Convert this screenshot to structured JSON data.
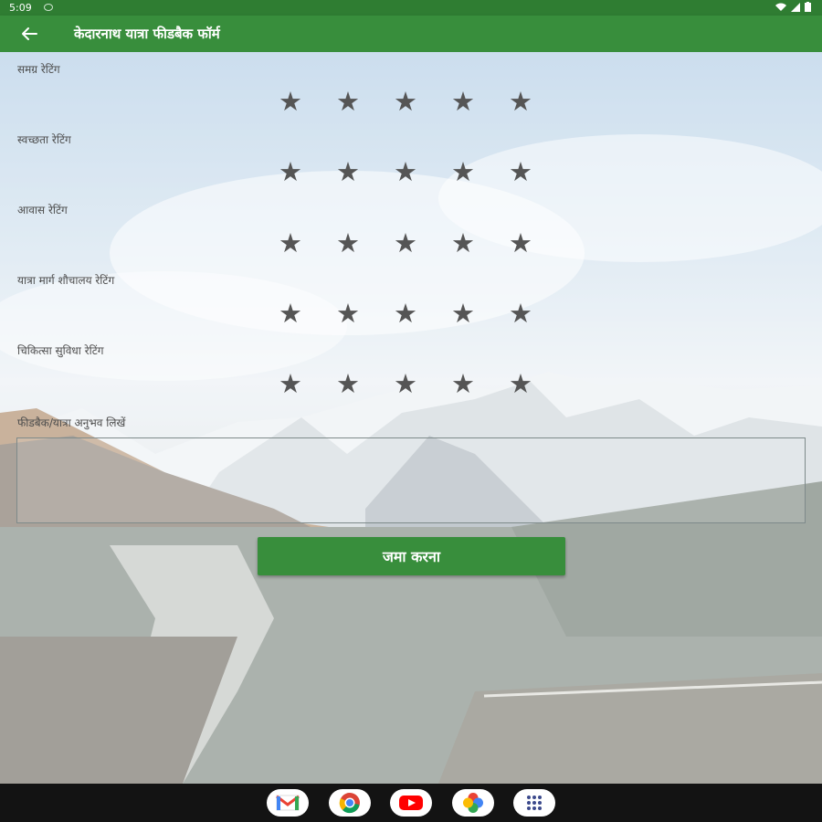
{
  "status_bar": {
    "time": "5:09",
    "icons": [
      "wifi-icon",
      "signal-icon",
      "battery-icon"
    ]
  },
  "app_bar": {
    "title": "केदारनाथ यात्रा फीडबैक फॉर्म",
    "back_icon": "arrow-left-icon"
  },
  "ratings": [
    {
      "label": "समग्र रेटिंग",
      "value": 0,
      "max": 5
    },
    {
      "label": "स्वच्छता रेटिंग",
      "value": 0,
      "max": 5
    },
    {
      "label": "आवास रेटिंग",
      "value": 0,
      "max": 5
    },
    {
      "label": "यात्रा मार्ग शौचालय रेटिंग",
      "value": 0,
      "max": 5
    },
    {
      "label": "चिकित्सा सुविधा रेटिंग",
      "value": 0,
      "max": 5
    }
  ],
  "feedback": {
    "label": "फीडबैक/यात्रा अनुभव लिखें",
    "value": ""
  },
  "submit": {
    "label": "जमा करना"
  },
  "dock": [
    "gmail-icon",
    "chrome-icon",
    "youtube-icon",
    "photos-icon",
    "app-drawer-icon"
  ],
  "colors": {
    "primary": "#388e3c",
    "status_bar": "#2f7d32",
    "star": "#555555",
    "nav_bar": "#131313"
  }
}
